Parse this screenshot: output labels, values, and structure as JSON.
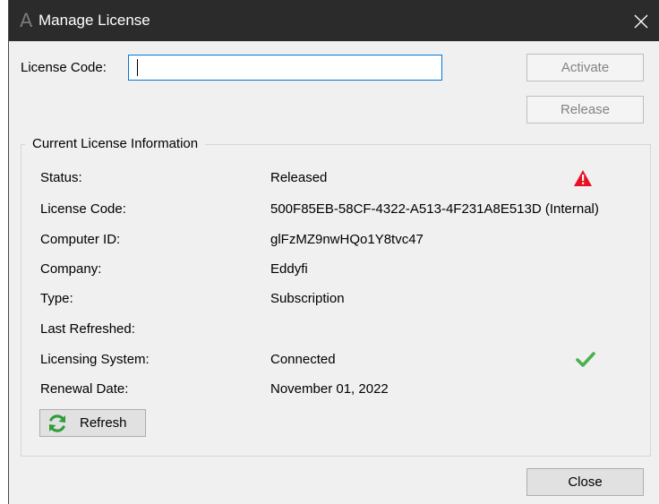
{
  "window": {
    "title": "Manage License",
    "logo_glyph": "A",
    "close_glyph": "×"
  },
  "license_code": {
    "label": "License Code:",
    "value": "",
    "placeholder": ""
  },
  "buttons": {
    "activate": "Activate",
    "release": "Release",
    "refresh": "Refresh",
    "close": "Close"
  },
  "current_info": {
    "title": "Current License Information",
    "rows": [
      {
        "label": "Status:",
        "value": "Released",
        "icon": "warning-icon"
      },
      {
        "label": "License Code:",
        "value": "500F85EB-58CF-4322-A513-4F231A8E513D (Internal)"
      },
      {
        "label": "Computer ID:",
        "value": "glFzMZ9nwHQo1Y8tvc47"
      },
      {
        "label": "Company:",
        "value": "Eddyfi"
      },
      {
        "label": "Type:",
        "value": "Subscription"
      },
      {
        "label": "Last Refreshed:",
        "value": ""
      },
      {
        "label": "Licensing System:",
        "value": "Connected",
        "icon": "checkmark-icon"
      },
      {
        "label": "Renewal Date:",
        "value": "November 01, 2022"
      }
    ]
  },
  "colors": {
    "titlebar": "#2b2b2b",
    "warning": "#e81123",
    "success": "#4caf50",
    "focus_border": "#0078d7",
    "refresh_icon": "#2e9e3a"
  }
}
